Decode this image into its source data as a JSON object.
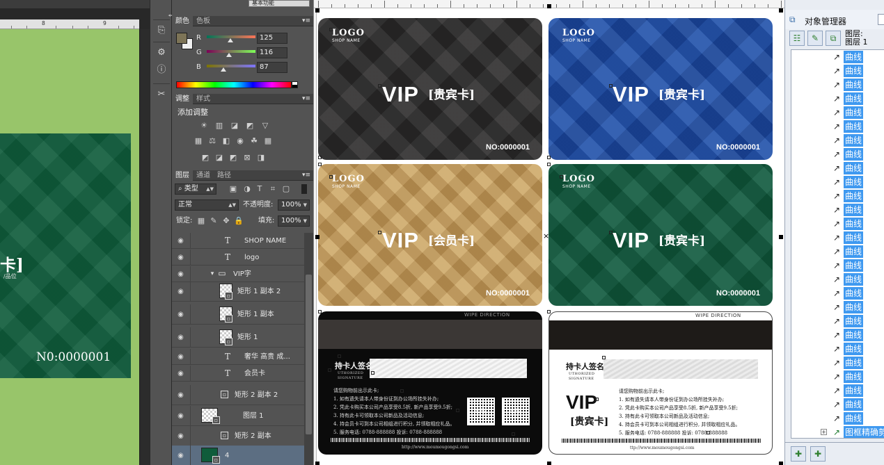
{
  "photoshop": {
    "workspace_label": "基本功能",
    "ruler_labels": [
      "8",
      "9"
    ],
    "canvas_card": {
      "title": "卡]",
      "subtitle": "/品位",
      "number": "N0:0000001"
    },
    "color_panel": {
      "tabs": [
        "颜色",
        "色板"
      ],
      "foreground_color": "#7d7457",
      "background_color": "#f0f0f0",
      "channels": [
        {
          "label": "R",
          "value": "125",
          "fraction": 0.49
        },
        {
          "label": "G",
          "value": "116",
          "fraction": 0.45
        },
        {
          "label": "B",
          "value": "87",
          "fraction": 0.34
        }
      ]
    },
    "adjustments_panel": {
      "tabs": [
        "调整",
        "样式"
      ],
      "title": "添加调整"
    },
    "layers_panel": {
      "tabs": [
        "图层",
        "通道",
        "路径"
      ],
      "filter_label": "类型",
      "blend_mode": "正常",
      "opacity_label": "不透明度:",
      "opacity_value": "100%",
      "lock_label": "锁定:",
      "fill_label": "填充:",
      "fill_value": "100%",
      "layers": [
        {
          "name": "SHOP NAME",
          "type": "text"
        },
        {
          "name": "logo",
          "type": "text"
        },
        {
          "name": "VIP字",
          "type": "group"
        },
        {
          "name": "矩形 1 副本 2",
          "type": "shape"
        },
        {
          "name": "矩形 1 副本",
          "type": "shape"
        },
        {
          "name": "矩形 1",
          "type": "shape"
        },
        {
          "name": "奢华 高贵 成...",
          "type": "text"
        },
        {
          "name": "会员卡",
          "type": "text"
        },
        {
          "name": "矩形 2 副本 2",
          "type": "smart"
        },
        {
          "name": "图层 1",
          "type": "image"
        },
        {
          "name": "矩形 2 副本",
          "type": "smart"
        },
        {
          "name": "4",
          "type": "image",
          "selected": true
        }
      ]
    }
  },
  "cards": [
    {
      "style": "dark",
      "logo": "LOGO",
      "shop": "SHOP NAME",
      "vip": "VIP",
      "kind": "[贵宾卡]",
      "number": "NO:0000001"
    },
    {
      "style": "blue",
      "logo": "LOGO",
      "shop": "SHOP NAME",
      "vip": "VIP",
      "kind": "[贵宾卡]",
      "number": "NO:0000001"
    },
    {
      "style": "gold",
      "logo": "LOGO",
      "shop": "SHOP NAME",
      "vip": "VIP",
      "kind": "[会员卡]",
      "number": "NO:0000001"
    },
    {
      "style": "green",
      "logo": "LOGO",
      "shop": "SHOP NAME",
      "vip": "VIP",
      "kind": "[贵宾卡]",
      "number": "NO:0000001"
    }
  ],
  "card_colors": {
    "dark": "#2b2a2a",
    "blue": "#1e4fa5",
    "gold": "#c7a163",
    "green": "#0f5a3d"
  },
  "back_cards": {
    "swipe": "WIPE DIRECTION",
    "signature_title": "持卡人签名",
    "signature_sub1": "UTHORIZED",
    "signature_sub2": "SIGNATURE",
    "rules": [
      "请您购物前出示此卡;",
      "1.  如有遗失请本人带身份证到办公场所挂失补办;",
      "2.  凭此卡购买本公司产品享受8.5折, 新产品享受9.5折;",
      "3.  持有此卡可领取本公司新品及活动信息;",
      "4.  持会员卡可到本公司相组进行积分, 并领取相应礼品。",
      "5.  服务电话: 0788-888888  投诉: 0788-888888"
    ],
    "rules_light": [
      "请您购物前出示此卡;",
      "1.  如有遗失请本人带身份证到办公场所挂失补办;",
      "2.  凭此卡购买本公司产品享受8.5折, 新产品享受9.5折;",
      "3.  持有此卡可领取本公司新品及活动信息;",
      "4.  持会员卡可到本公司相组进行积分, 并领取相应礼品。",
      "5.  服务电话: 0788-888888  投诉: 0788-888888"
    ],
    "qr_label": "二维码",
    "url": "http://www.moumougongsi.com",
    "url_light": "ttp://www.moumougongsi.com",
    "vip": "VIP",
    "kind": "[贵宾卡]"
  },
  "object_manager": {
    "title": "对象管理器",
    "layer_label_1": "图层:",
    "layer_label_2": "图层 1",
    "items": [
      "曲线",
      "曲线",
      "曲线",
      "曲线",
      "曲线",
      "曲线",
      "曲线",
      "曲线",
      "曲线",
      "曲线",
      "曲线",
      "曲线",
      "曲线",
      "曲线",
      "曲线",
      "曲线",
      "曲线",
      "曲线",
      "曲线",
      "曲线",
      "曲线",
      "曲线",
      "曲线",
      "曲线",
      "曲线",
      "曲线",
      "曲线"
    ],
    "last_item": "图框精确剪"
  }
}
